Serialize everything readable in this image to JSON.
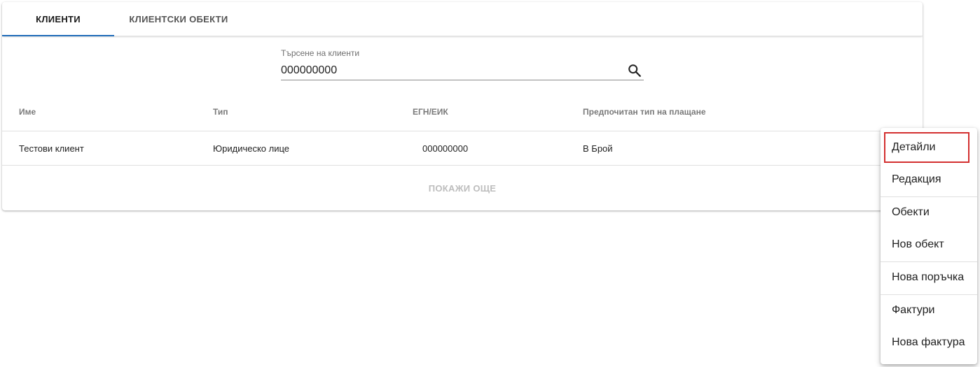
{
  "tabs": [
    {
      "label": "КЛИЕНТИ",
      "active": true
    },
    {
      "label": "КЛИЕНТСКИ ОБЕКТИ",
      "active": false
    }
  ],
  "search": {
    "label": "Търсене на клиенти",
    "value": "000000000",
    "icon": "search-icon"
  },
  "table": {
    "headers": [
      "Име",
      "Тип",
      "ЕГН/ЕИК",
      "Предпочитан тип на плащане"
    ],
    "rows": [
      [
        "Тестови клиент",
        "Юридическо лице",
        "000000000",
        "В Брой"
      ]
    ]
  },
  "show_more_label": "ПОКАЖИ ОЩЕ",
  "menu": {
    "items": [
      {
        "label": "Детайли",
        "highlighted": true
      },
      {
        "label": "Редакция"
      },
      {
        "label": "Обекти"
      },
      {
        "label": "Нов обект"
      },
      {
        "label": "Нова поръчка"
      },
      {
        "label": "Фактури"
      },
      {
        "label": "Нова фактура"
      }
    ]
  },
  "colors": {
    "accent": "#1e6ab8",
    "highlight_border": "#d32f2f",
    "disabled_text": "#bdbdbd"
  }
}
